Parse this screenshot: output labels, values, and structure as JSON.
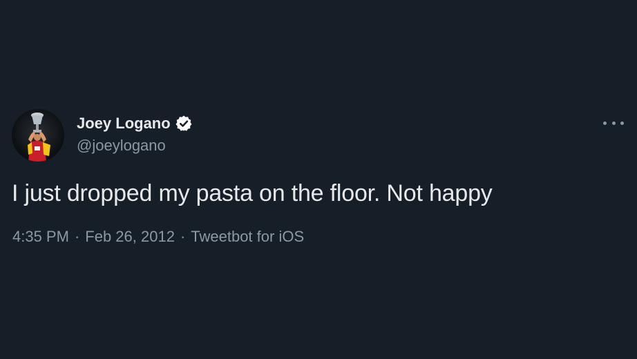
{
  "tweet": {
    "author": {
      "display_name": "Joey Logano",
      "handle": "@joeylogano",
      "verified": true,
      "verified_icon": "verified-badge-icon",
      "avatar_icon": "profile-photo-trophy"
    },
    "text": "I just dropped my pasta on the floor. Not happy",
    "meta": {
      "time": "4:35 PM",
      "separator": "·",
      "date": "Feb 26, 2012",
      "source": "Tweetbot for iOS"
    },
    "more_icon": "more-options-icon"
  },
  "colors": {
    "background": "#161e28",
    "primary_text": "#e7e9ea",
    "secondary_text": "#8b98a5"
  }
}
